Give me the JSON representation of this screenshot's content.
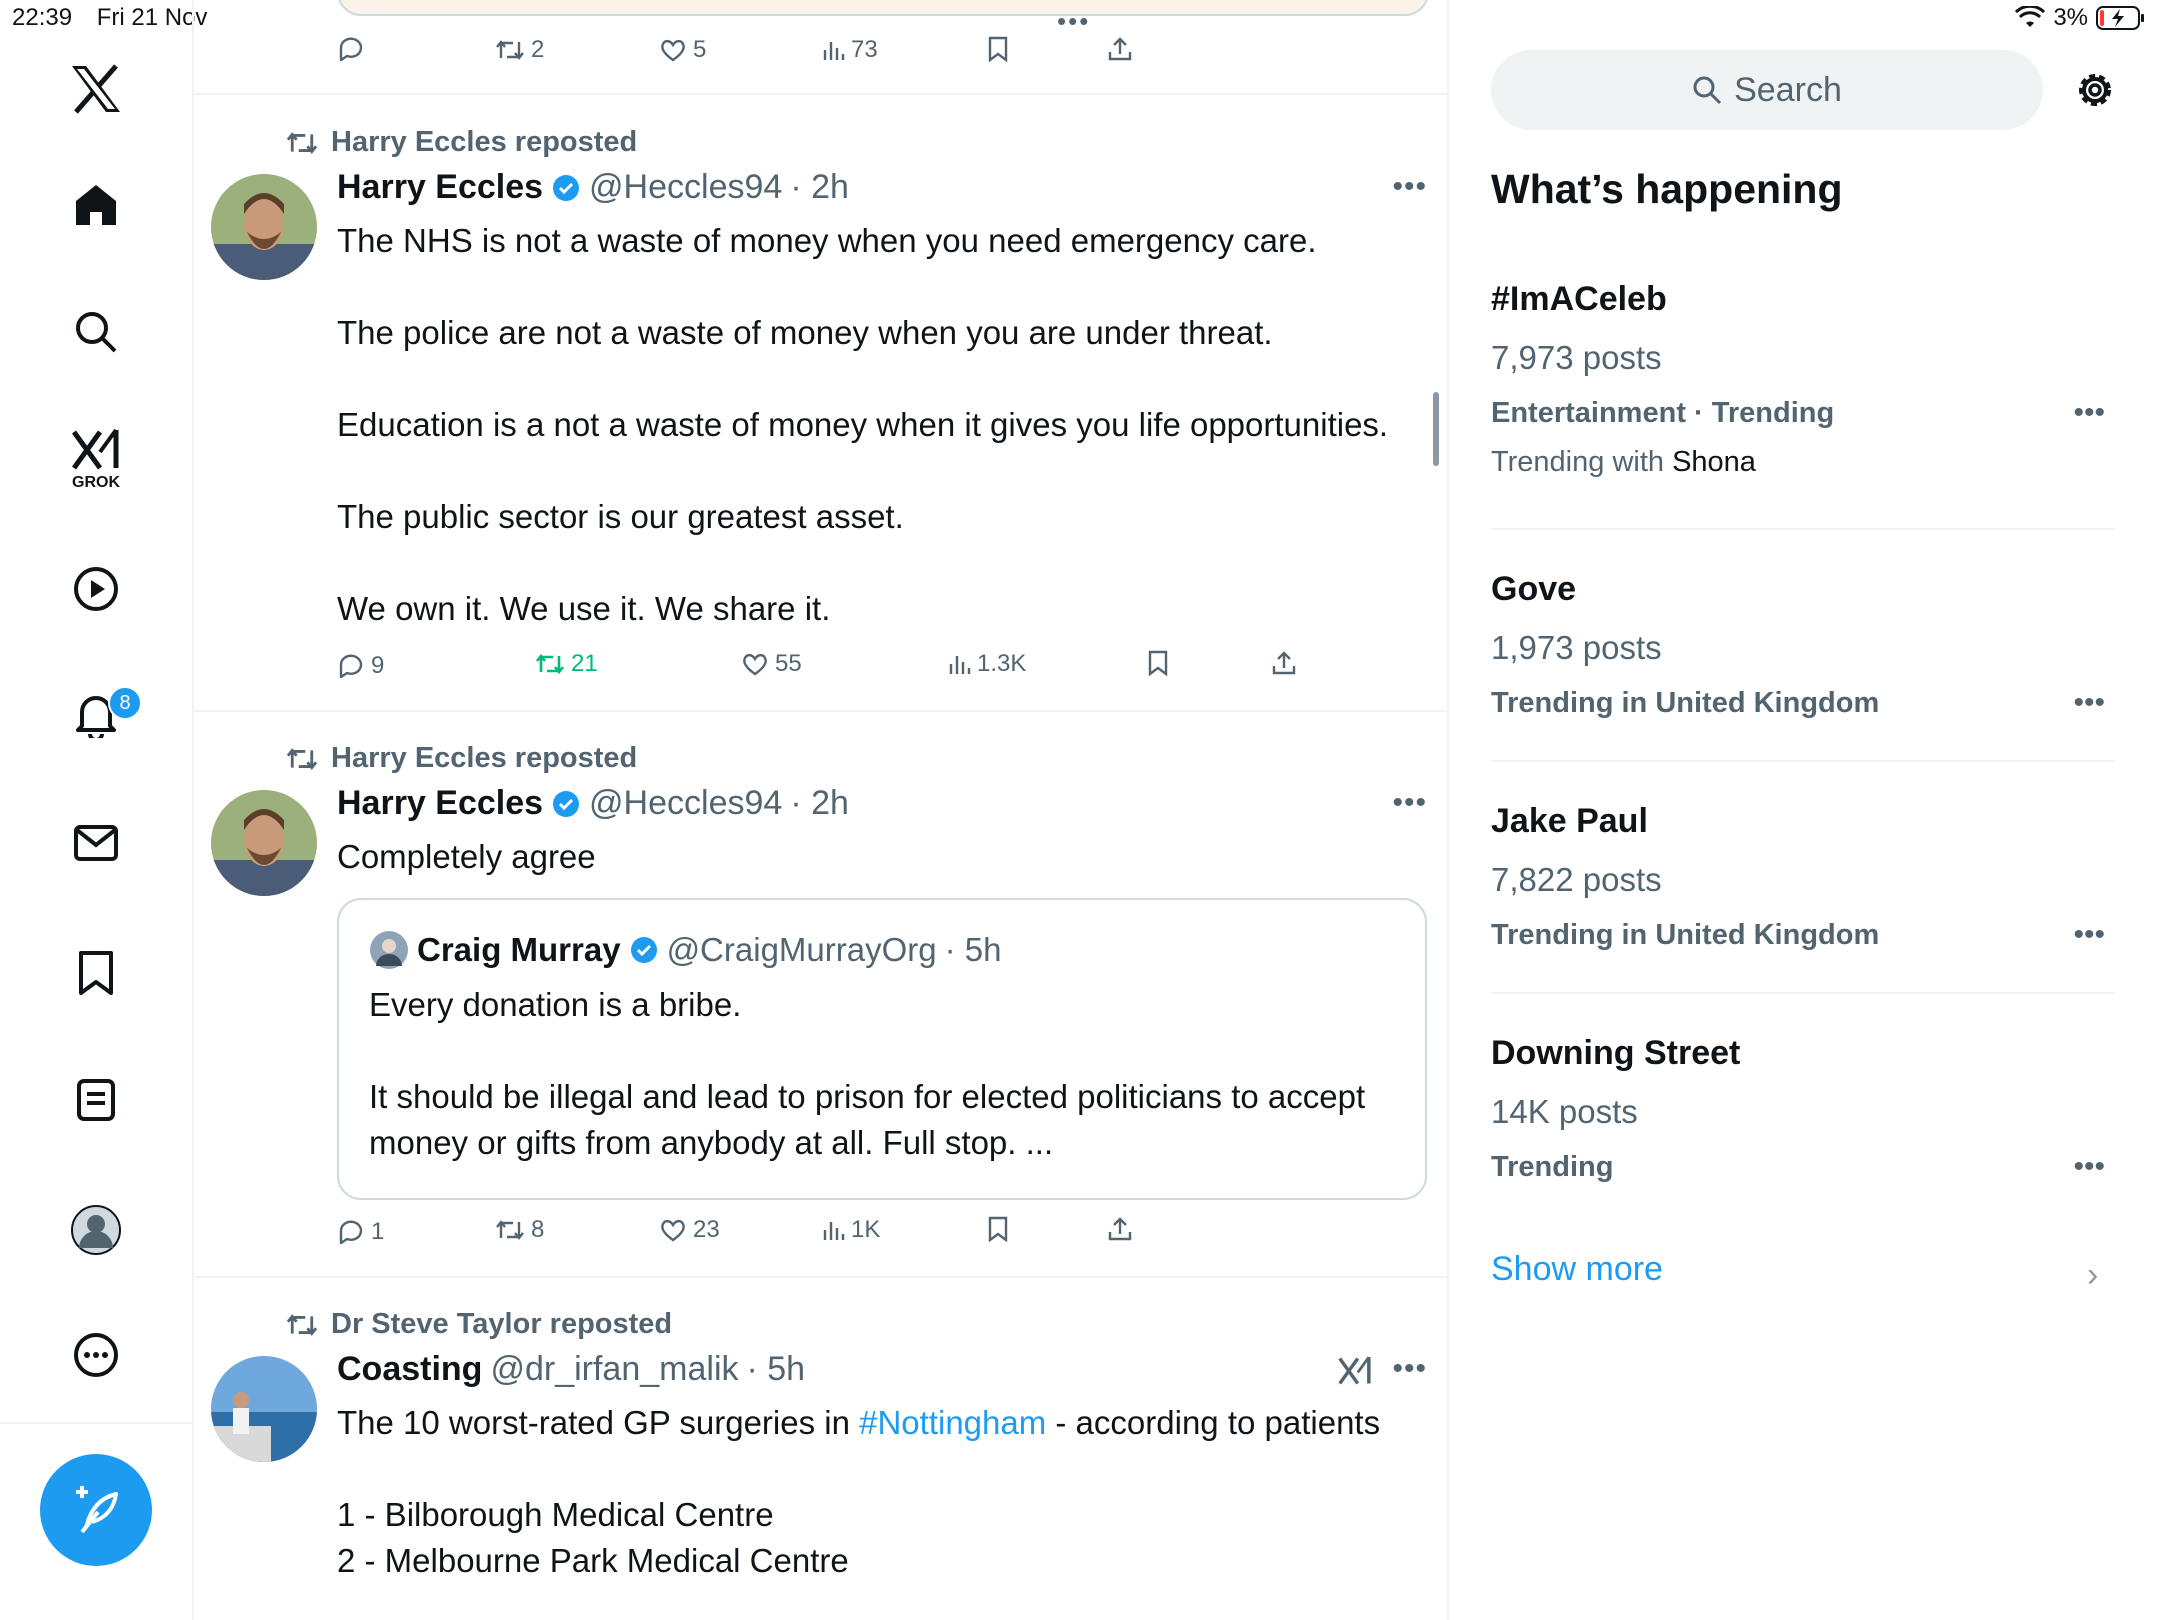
{
  "status": {
    "time": "22:39",
    "date": "Fri 21 Nov",
    "battery": "3%"
  },
  "nav": {
    "grok_label": "GROK",
    "notifications_count": "8"
  },
  "feed": {
    "prev_tweet": {
      "replies": "",
      "reposts": "2",
      "likes": "5",
      "views": "73"
    },
    "tweets": [
      {
        "reposted_by": "Harry Eccles reposted",
        "name": "Harry Eccles",
        "handle": "@Heccles94",
        "time": "· 2h",
        "paragraphs": [
          "The NHS is not a waste of money when you need emergency care.",
          "The police are not a waste of money when you are under threat.",
          "Education is a not a waste of money when it gives you life opportunities.",
          "The public sector is our greatest asset.",
          "We own it. We use it. We share it."
        ],
        "replies": "9",
        "reposts": "21",
        "likes": "55",
        "views": "1.3K"
      },
      {
        "reposted_by": "Harry Eccles reposted",
        "name": "Harry Eccles",
        "handle": "@Heccles94",
        "time": "· 2h",
        "text": "Completely agree",
        "quote": {
          "name": "Craig Murray",
          "handle": "@CraigMurrayOrg",
          "time": "· 5h",
          "p1": "Every donation is a bribe.",
          "p2": "It should be illegal and lead to prison for elected politicians to accept money or gifts from anybody at all. Full stop. ..."
        },
        "replies": "1",
        "reposts": "8",
        "likes": "23",
        "views": "1K"
      },
      {
        "reposted_by": "Dr Steve Taylor reposted",
        "name": "Coasting",
        "handle": "@dr_irfan_malik",
        "time": "· 5h",
        "text_before": "The 10 worst-rated GP surgeries in ",
        "hashtag": "#Nottingham",
        "text_after": " - according to patients",
        "list": [
          "1 - Bilborough Medical Centre",
          "2 - Melbourne Park Medical Centre"
        ]
      }
    ]
  },
  "sidebar": {
    "search_placeholder": "Search",
    "heading": "What’s happening",
    "trends": [
      {
        "title": "#ImACeleb",
        "posts": "7,973 posts",
        "context": "Entertainment · Trending",
        "with_label": "Trending with ",
        "with_name": "Shona"
      },
      {
        "title": "Gove",
        "posts": "1,973 posts",
        "context": "Trending in United Kingdom"
      },
      {
        "title": "Jake Paul",
        "posts": "7,822 posts",
        "context": "Trending in United Kingdom"
      },
      {
        "title": "Downing Street",
        "posts": "14K posts",
        "context": "Trending"
      }
    ],
    "show_more": "Show more"
  },
  "colors": {
    "accent": "#1d9bf0",
    "repost_active": "#00ba7c",
    "secondary_text": "#536471"
  }
}
